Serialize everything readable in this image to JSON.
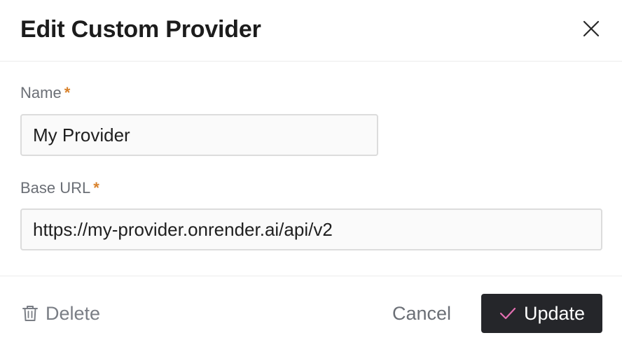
{
  "dialog": {
    "title": "Edit Custom Provider",
    "close_icon": "close-icon"
  },
  "form": {
    "name": {
      "label": "Name",
      "required_marker": "*",
      "value": "My Provider"
    },
    "base_url": {
      "label": "Base URL",
      "required_marker": "*",
      "value": "https://my-provider.onrender.ai/api/v2"
    }
  },
  "footer": {
    "delete_label": "Delete",
    "delete_icon": "trash-icon",
    "cancel_label": "Cancel",
    "update_label": "Update",
    "update_icon": "checkmark-icon"
  },
  "colors": {
    "required_marker": "#d9822b",
    "primary_button_bg": "#25262a",
    "checkmark_accent": "#e46fb1",
    "muted_text": "#6b6f76"
  }
}
